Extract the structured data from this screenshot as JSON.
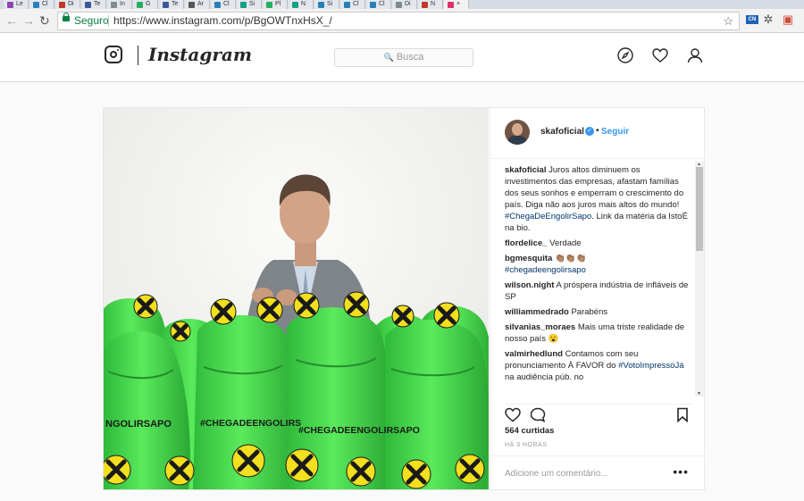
{
  "browser": {
    "tabs": [
      {
        "label": "Le"
      },
      {
        "label": "Cl"
      },
      {
        "label": "Di"
      },
      {
        "label": "Te"
      },
      {
        "label": "In"
      },
      {
        "label": "G"
      },
      {
        "label": "Te"
      },
      {
        "label": "Ar"
      },
      {
        "label": "Cl"
      },
      {
        "label": "Si"
      },
      {
        "label": "Pl"
      },
      {
        "label": "N"
      },
      {
        "label": "Si"
      },
      {
        "label": "Cl"
      },
      {
        "label": "Cl"
      },
      {
        "label": "Di"
      },
      {
        "label": "N"
      },
      {
        "label": "×"
      }
    ],
    "secure_label": "Seguro",
    "url": "https://www.instagram.com/p/BgOWTnxHsX_/",
    "ext_badge": "CN"
  },
  "header": {
    "wordmark": "Instagram",
    "search_placeholder": "Busca",
    "icons": [
      "compass-icon",
      "heart-icon",
      "user-icon"
    ]
  },
  "post": {
    "username": "skafoficial",
    "follow_label": "Seguir",
    "caption": {
      "user": "skafoficial",
      "text": "Juros altos diminuem os investimentos das empresas, afastam famílias dos seus sonhos e emperram o crescimento do país. Diga não aos juros mais altos do mundo!",
      "hashtag": "#ChegaDeEngolirSapo",
      "suffix": ". Link da matéria da IstoÉ na bio."
    },
    "comments": [
      {
        "user": "flordelice_",
        "text": "Verdade"
      },
      {
        "user": "bgmesquita",
        "text": "👏🏽👏🏽👏🏽"
      },
      {
        "user": "",
        "text": "#chegadeengolirsapo"
      },
      {
        "user": "wilson.night",
        "text": "A próspera indústria de infláveis de SP"
      },
      {
        "user": "williammedrado",
        "text": "Parabéns"
      },
      {
        "user": "silvanias_moraes",
        "text": "Mais uma triste realidade de nosso país 😮"
      },
      {
        "user": "valmirhedlund",
        "text": "Contamos com seu pronunciamento À FAVOR do"
      },
      {
        "user": "",
        "text": "#VotoImpressoJá"
      },
      {
        "user": "",
        "text": "na audiência púb. no"
      }
    ],
    "likes": "564 curtidas",
    "time_ago": "HÁ 3 HORAS",
    "comment_placeholder": "Adicione um comentário...",
    "banner_text": [
      "NGOLIRSAPO",
      "#CHEGADEENGOLIRS",
      "#CHEGADEENGOLIRSAPO"
    ]
  },
  "colors": {
    "accent": "#3897f0",
    "frog_green": "#3fd94a",
    "frog_yellow": "#f2df1e"
  }
}
